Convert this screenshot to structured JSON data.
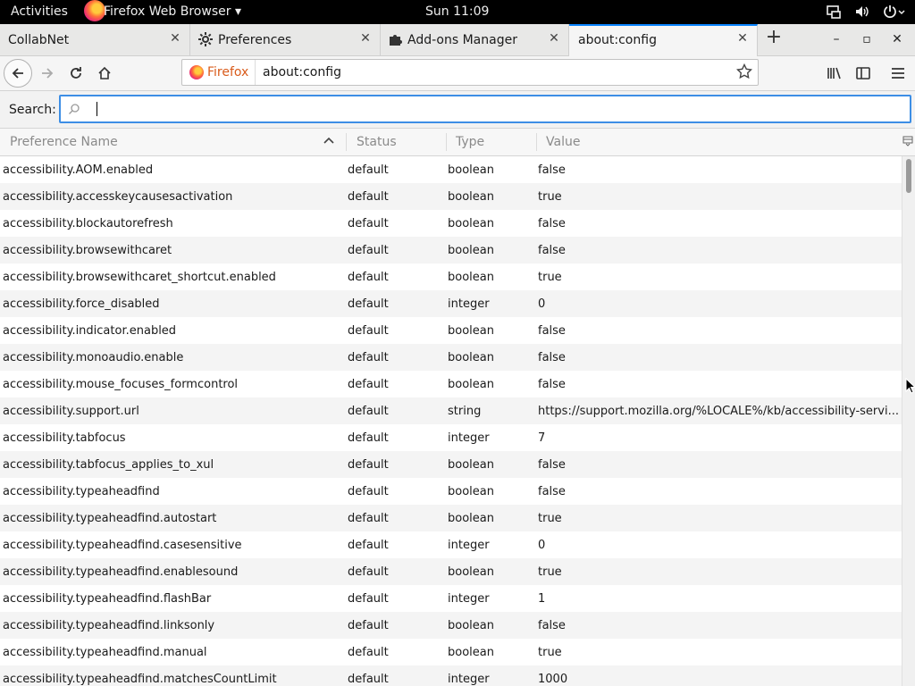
{
  "topbar": {
    "activities": "Activities",
    "app_menu": "Firefox Web Browser ▾",
    "clock": "Sun 11:09"
  },
  "tabs": [
    {
      "label": "CollabNet",
      "icon": "none"
    },
    {
      "label": "Preferences",
      "icon": "gear-icon"
    },
    {
      "label": "Add-ons Manager",
      "icon": "puzzle-icon"
    },
    {
      "label": "about:config",
      "icon": "none"
    }
  ],
  "tab_close": "✕",
  "window_controls": {
    "minimize": "–",
    "maximize": "▫",
    "close": "✕"
  },
  "newtab": "+",
  "urlbar": {
    "identity_label": "Firefox",
    "url": "about:config"
  },
  "search": {
    "label": "Search:",
    "value": ""
  },
  "columns": {
    "name": "Preference Name",
    "status": "Status",
    "type": "Type",
    "value": "Value"
  },
  "rows": [
    {
      "name": "accessibility.AOM.enabled",
      "status": "default",
      "type": "boolean",
      "value": "false"
    },
    {
      "name": "accessibility.accesskeycausesactivation",
      "status": "default",
      "type": "boolean",
      "value": "true"
    },
    {
      "name": "accessibility.blockautorefresh",
      "status": "default",
      "type": "boolean",
      "value": "false"
    },
    {
      "name": "accessibility.browsewithcaret",
      "status": "default",
      "type": "boolean",
      "value": "false"
    },
    {
      "name": "accessibility.browsewithcaret_shortcut.enabled",
      "status": "default",
      "type": "boolean",
      "value": "true"
    },
    {
      "name": "accessibility.force_disabled",
      "status": "default",
      "type": "integer",
      "value": "0"
    },
    {
      "name": "accessibility.indicator.enabled",
      "status": "default",
      "type": "boolean",
      "value": "false"
    },
    {
      "name": "accessibility.monoaudio.enable",
      "status": "default",
      "type": "boolean",
      "value": "false"
    },
    {
      "name": "accessibility.mouse_focuses_formcontrol",
      "status": "default",
      "type": "boolean",
      "value": "false"
    },
    {
      "name": "accessibility.support.url",
      "status": "default",
      "type": "string",
      "value": "https://support.mozilla.org/%LOCALE%/kb/accessibility-servi..."
    },
    {
      "name": "accessibility.tabfocus",
      "status": "default",
      "type": "integer",
      "value": "7"
    },
    {
      "name": "accessibility.tabfocus_applies_to_xul",
      "status": "default",
      "type": "boolean",
      "value": "false"
    },
    {
      "name": "accessibility.typeaheadfind",
      "status": "default",
      "type": "boolean",
      "value": "false"
    },
    {
      "name": "accessibility.typeaheadfind.autostart",
      "status": "default",
      "type": "boolean",
      "value": "true"
    },
    {
      "name": "accessibility.typeaheadfind.casesensitive",
      "status": "default",
      "type": "integer",
      "value": "0"
    },
    {
      "name": "accessibility.typeaheadfind.enablesound",
      "status": "default",
      "type": "boolean",
      "value": "true"
    },
    {
      "name": "accessibility.typeaheadfind.flashBar",
      "status": "default",
      "type": "integer",
      "value": "1"
    },
    {
      "name": "accessibility.typeaheadfind.linksonly",
      "status": "default",
      "type": "boolean",
      "value": "false"
    },
    {
      "name": "accessibility.typeaheadfind.manual",
      "status": "default",
      "type": "boolean",
      "value": "true"
    },
    {
      "name": "accessibility.typeaheadfind.matchesCountLimit",
      "status": "default",
      "type": "integer",
      "value": "1000"
    }
  ],
  "colors": {
    "accent": "#0a84ff",
    "search_focus": "#3d8ee5",
    "identity": "#d95b1b"
  }
}
